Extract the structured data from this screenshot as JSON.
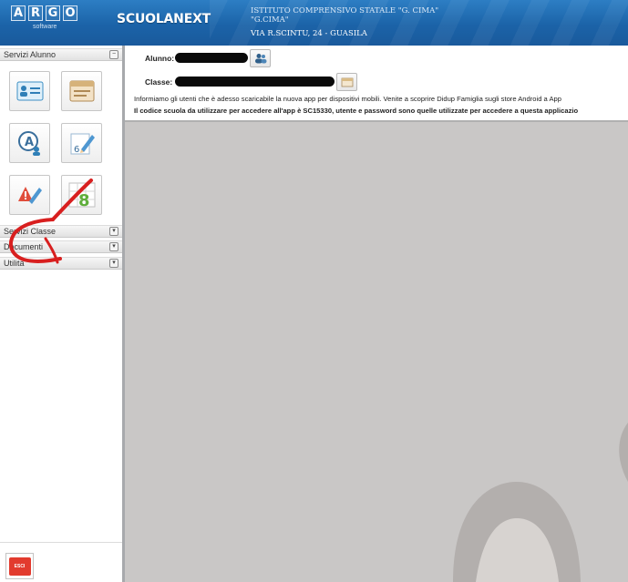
{
  "header": {
    "logo_letters": [
      "A",
      "R",
      "G",
      "O"
    ],
    "logo_subtitle": "software",
    "app_name": "SCUOLANEXT",
    "school_line1": "ISTITUTO COMPRENSIVO STATALE \"G. CIMA\"",
    "school_line2": "\"G.CIMA\"",
    "school_address": "VIA R.SCINTU, 24 - GUASILA"
  },
  "sidebar": {
    "panels": [
      {
        "label": "Servizi Alunno"
      },
      {
        "label": "Servizi Classe"
      },
      {
        "label": "Documenti"
      },
      {
        "label": "Utilità"
      }
    ],
    "exit_label": "ESCI"
  },
  "student": {
    "alunno_label": "Alunno:",
    "classe_label": "Classe:"
  },
  "notice": {
    "line1": "Informiamo gli utenti che è adesso scaricabile la nuova app per dispositivi mobili. Venite a scoprire Didup Famiglia sugli store Android a App",
    "line2": "Il codice scuola da utilizzare per accedere all'app è SC15330, utente e password sono quelle utilizzate per accedere a questa applicazio"
  },
  "colors": {
    "header_blue": "#1b63a8",
    "annotation_red": "#d81f1f",
    "exit_red": "#e23b2e"
  }
}
